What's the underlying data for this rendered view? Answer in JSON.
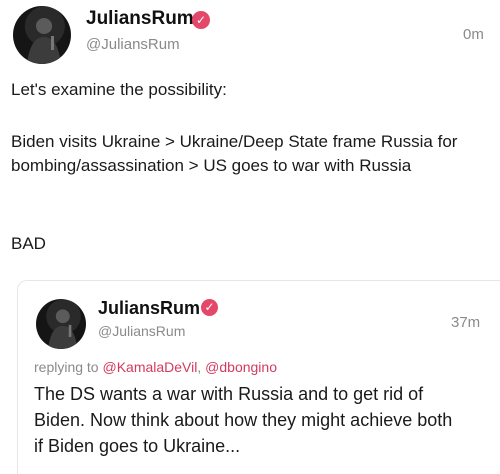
{
  "post": {
    "display_name": "JuliansRum",
    "handle": "@JuliansRum",
    "time": "0m",
    "line1": "Let's examine the possibility:",
    "line2": "Biden visits Ukraine > Ukraine/Deep State frame Russia for bombing/assassination > US goes to war with Russia",
    "line3": "BAD"
  },
  "reply": {
    "display_name": "JuliansRum",
    "handle": "@JuliansRum",
    "time": "37m",
    "replying_prefix": "replying to",
    "mention1": "@KamalaDeVil",
    "mention2": "@dbongino",
    "text": "The DS wants a war with Russia and to get rid of Biden. Now think about how they might achieve both if Biden goes to Ukraine..."
  },
  "colors": {
    "verified_badge": "#e3486a",
    "mention": "#d43a5e"
  },
  "icons": {
    "verified": "verified-badge-icon",
    "avatar": "avatar-image"
  }
}
